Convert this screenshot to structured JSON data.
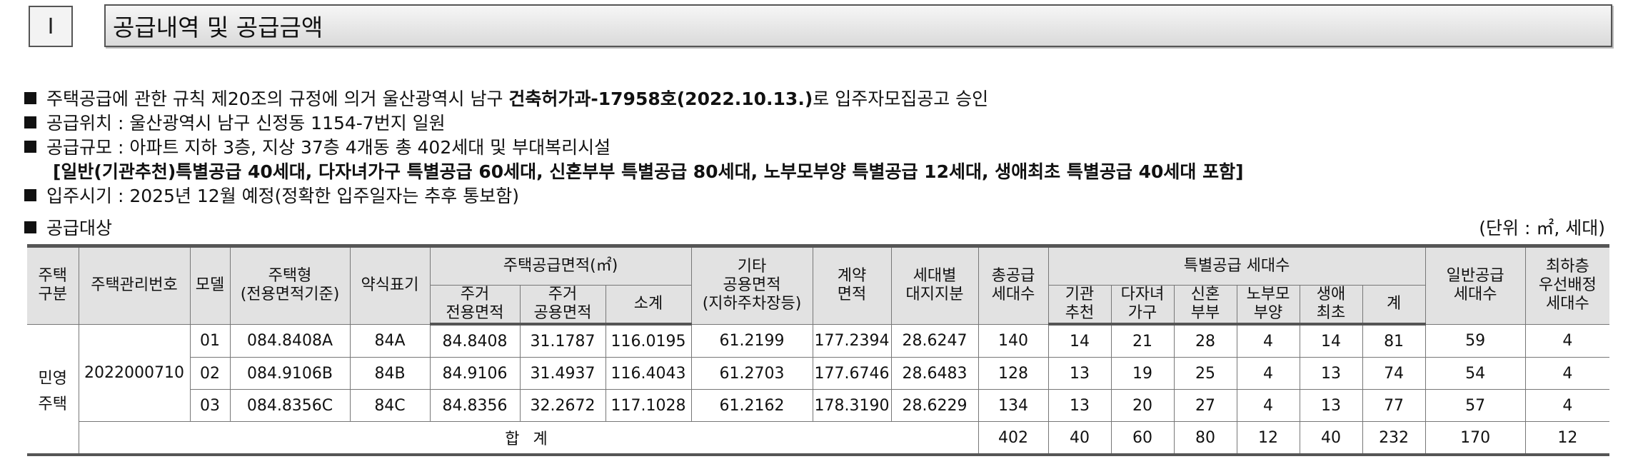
{
  "section": {
    "number": "Ⅰ",
    "title": "공급내역 및 공급금액"
  },
  "bullets": {
    "approval_pre": "주택공급에 관한 규칙 제20조의 규정에 의거 울산광역시 남구 ",
    "approval_bold": "건축허가과-17958호(2022.10.13.)",
    "approval_post": "로 입주자모집공고 승인",
    "location": "공급위치 : 울산광역시 남구 신정동 1154-7번지 일원",
    "scale": "공급규모 : 아파트 지하 3층, 지상 37층 4개동 총 402세대 및 부대복리시설",
    "special": "[일반(기관추천)특별공급 40세대, 다자녀가구 특별공급 60세대, 신혼부부 특별공급 80세대, 노부모부양 특별공급 12세대, 생애최초 특별공급 40세대 포함]",
    "move_in": "입주시기 : 2025년 12월 예정(정확한 입주일자는 추후 통보함)",
    "target": "공급대상",
    "unit": "(단위 : ㎡, 세대)"
  },
  "table": {
    "h": {
      "type1": "주택",
      "type2": "구분",
      "mgmt": "주택관리번호",
      "model": "모델",
      "htype1": "주택형",
      "htype2": "(전용면적기준)",
      "short": "약식표기",
      "area": "주택공급면적(㎡)",
      "excl1": "주거",
      "excl2": "전용면적",
      "comm1": "주거",
      "comm2": "공용면적",
      "sub": "소계",
      "etc1": "기타",
      "etc2": "공용면적",
      "etc3": "(지하주차장등)",
      "contract1": "계약",
      "contract2": "면적",
      "land1": "세대별",
      "land2": "대지지분",
      "total1": "총공급",
      "total2": "세대수",
      "special": "특별공급 세대수",
      "inst1": "기관",
      "inst2": "추천",
      "multi1": "다자녀",
      "multi2": "가구",
      "newly1": "신혼",
      "newly2": "부부",
      "parent1": "노부모",
      "parent2": "부양",
      "first1": "생애",
      "first2": "최초",
      "ssum": "계",
      "general1": "일반공급",
      "general2": "세대수",
      "low1": "최하층",
      "low2": "우선배정",
      "low3": "세대수"
    },
    "group1": "민영",
    "group2": "주택",
    "mgmt_no": "2022000710",
    "rows": [
      {
        "model": "01",
        "type": "084.8408A",
        "short": "84A",
        "excl": "84.8408",
        "comm": "31.1787",
        "sub": "116.0195",
        "etc": "61.2199",
        "contract": "177.2394",
        "land": "28.6247",
        "total": "140",
        "inst": "14",
        "multi": "21",
        "newly": "28",
        "parent": "4",
        "first": "14",
        "ssum": "81",
        "general": "59",
        "low": "4"
      },
      {
        "model": "02",
        "type": "084.9106B",
        "short": "84B",
        "excl": "84.9106",
        "comm": "31.4937",
        "sub": "116.4043",
        "etc": "61.2703",
        "contract": "177.6746",
        "land": "28.6483",
        "total": "128",
        "inst": "13",
        "multi": "19",
        "newly": "25",
        "parent": "4",
        "first": "13",
        "ssum": "74",
        "general": "54",
        "low": "4"
      },
      {
        "model": "03",
        "type": "084.8356C",
        "short": "84C",
        "excl": "84.8356",
        "comm": "32.2672",
        "sub": "117.1028",
        "etc": "61.2162",
        "contract": "178.3190",
        "land": "28.6229",
        "total": "134",
        "inst": "13",
        "multi": "20",
        "newly": "27",
        "parent": "4",
        "first": "13",
        "ssum": "77",
        "general": "57",
        "low": "4"
      }
    ],
    "sum": {
      "label": "합 계",
      "total": "402",
      "inst": "40",
      "multi": "60",
      "newly": "80",
      "parent": "12",
      "first": "40",
      "ssum": "232",
      "general": "170",
      "low": "12"
    }
  }
}
